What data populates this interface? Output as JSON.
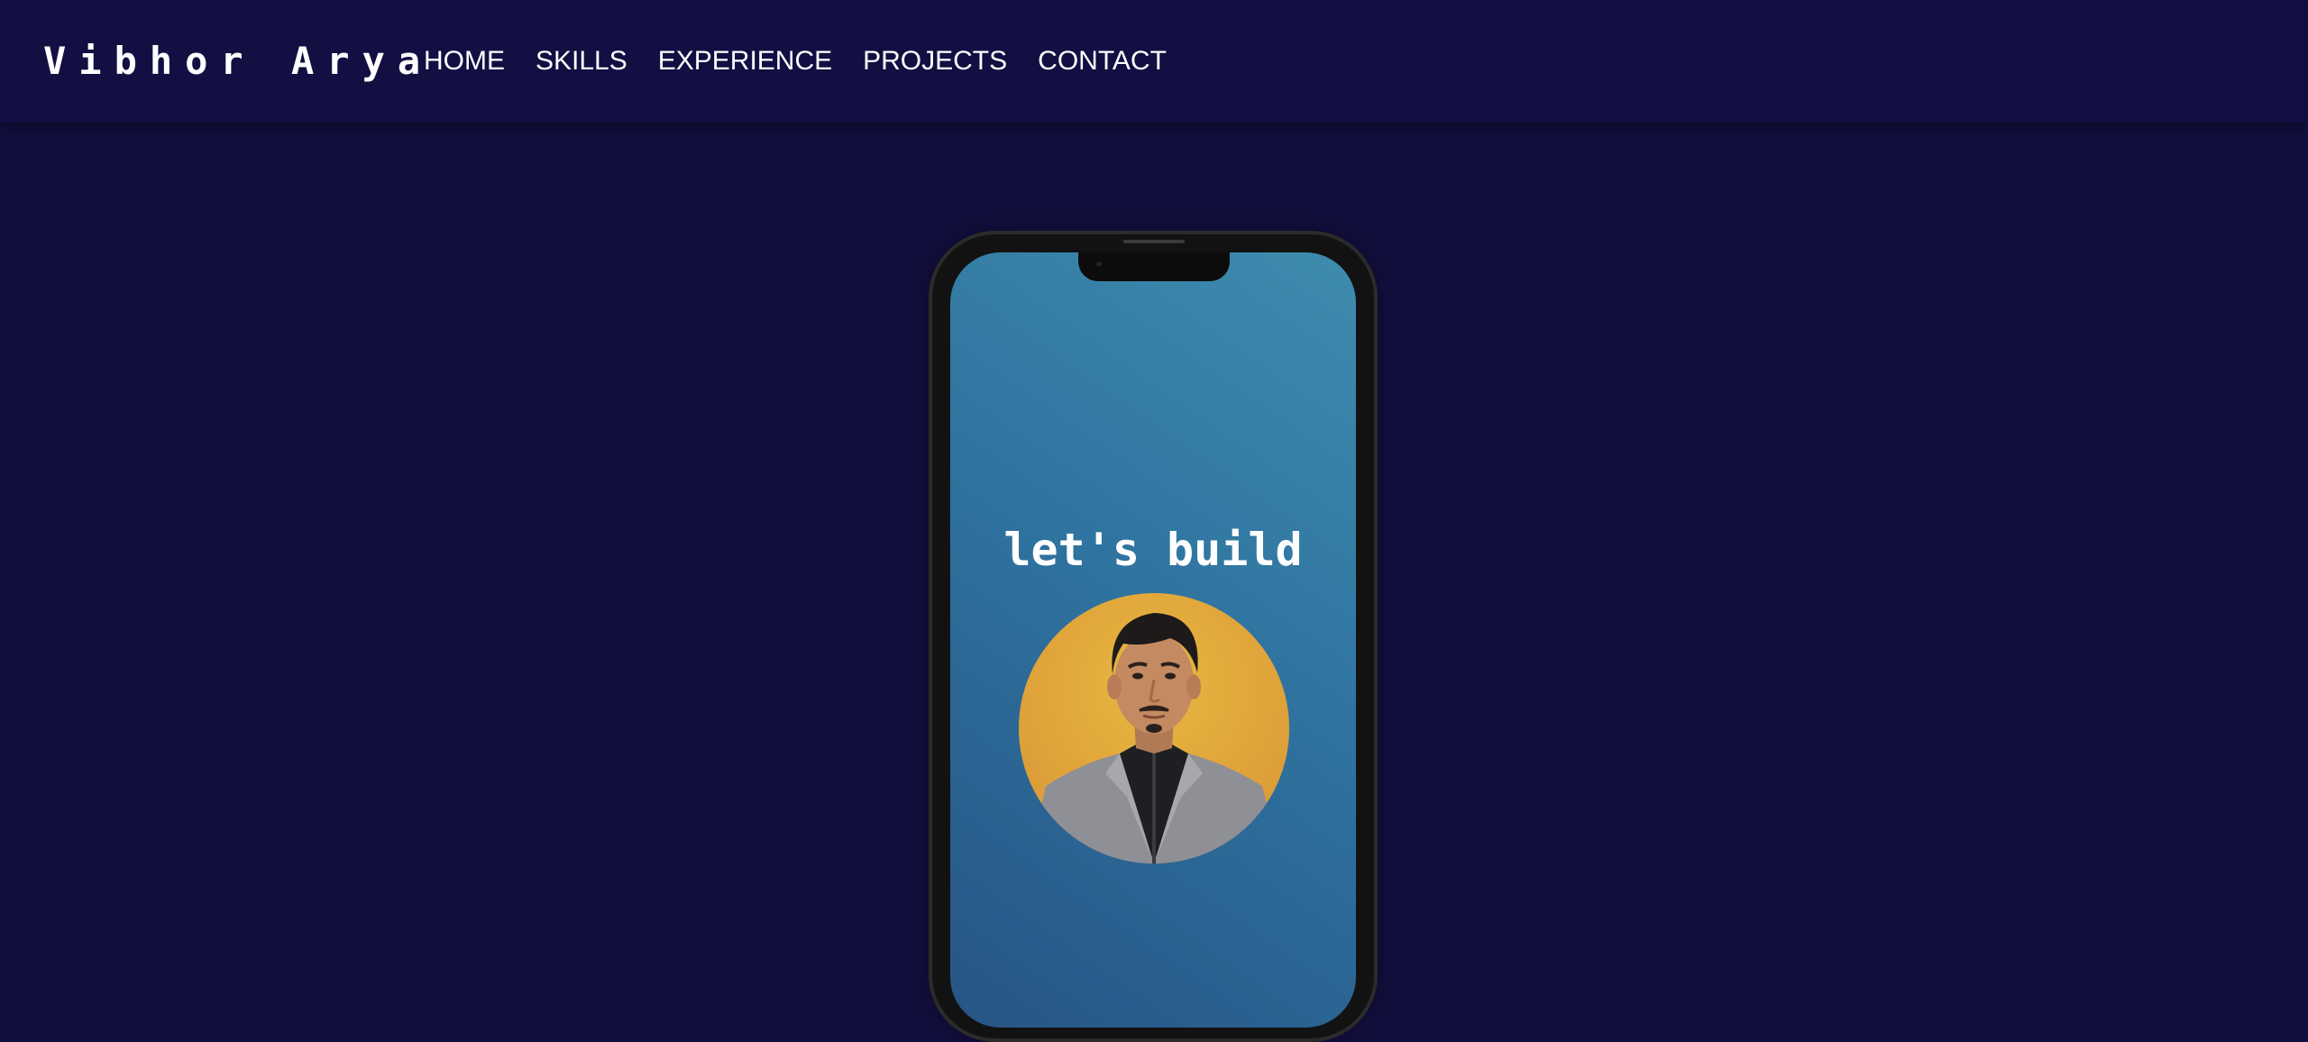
{
  "header": {
    "brand": "Vibhor Arya",
    "nav": [
      {
        "label": "HOME"
      },
      {
        "label": "SKILLS"
      },
      {
        "label": "EXPERIENCE"
      },
      {
        "label": "PROJECTS"
      },
      {
        "label": "CONTACT"
      }
    ]
  },
  "hero": {
    "headline": "let's build",
    "avatar_icon": "profile-photo"
  },
  "colors": {
    "background": "#120f3e",
    "navbar": "#130f42",
    "screen_top": "#3e8cae",
    "screen_bottom": "#275485",
    "avatar_bg": "#e0a33a",
    "text": "#ffffff"
  }
}
